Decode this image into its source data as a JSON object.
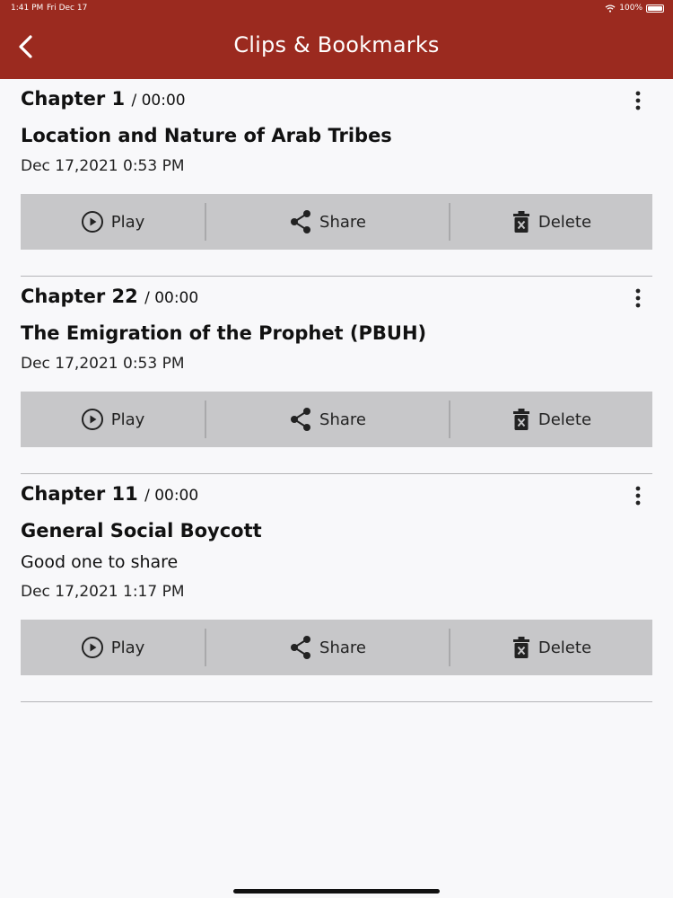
{
  "status": {
    "time": "1:41 PM",
    "date": "Fri Dec 17",
    "battery": "100%"
  },
  "header": {
    "title": "Clips & Bookmarks",
    "back_icon": "chevron-left-icon"
  },
  "actions": {
    "play": "Play",
    "share": "Share",
    "delete": "Delete"
  },
  "clips": [
    {
      "chapter": "Chapter 1",
      "duration": "/ 00:00",
      "title": "Location and Nature of Arab Tribes",
      "note": "",
      "date": "Dec 17,2021 0:53 PM"
    },
    {
      "chapter": "Chapter 22",
      "duration": "/ 00:00",
      "title": "The Emigration of the Prophet (PBUH)",
      "note": "",
      "date": "Dec 17,2021 0:53 PM"
    },
    {
      "chapter": "Chapter 11",
      "duration": "/ 00:00",
      "title": "General Social Boycott",
      "note": "Good one to share",
      "date": "Dec 17,2021 1:17 PM"
    }
  ],
  "colors": {
    "header": "#9b2a1f",
    "action_bar": "#c7c7c9",
    "background": "#f8f8fa"
  }
}
